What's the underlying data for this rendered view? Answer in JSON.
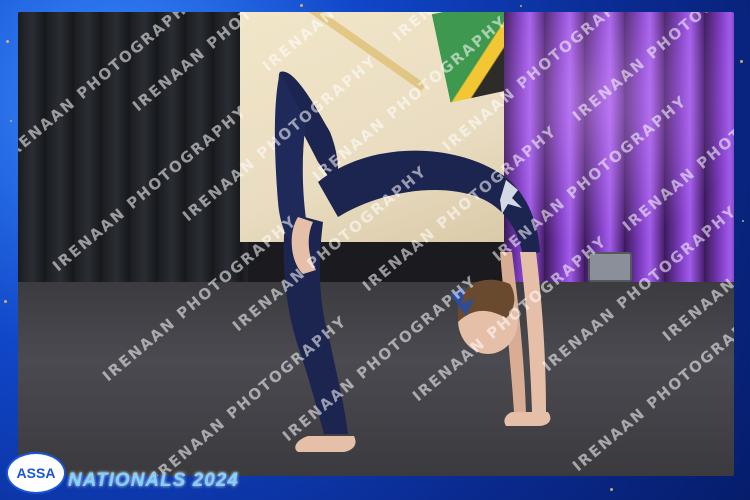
{
  "watermark": {
    "text": "IRENAAN PHOTOGRAPHY"
  },
  "branding": {
    "logo_text": "ASSA",
    "event_title": "NATIONALS 2024"
  },
  "colors": {
    "frame_blue": "#1046c8",
    "gold_speck": "#e8c45a",
    "leotard_navy": "#1c2450",
    "curtain_purple": "#7d3cc0"
  }
}
